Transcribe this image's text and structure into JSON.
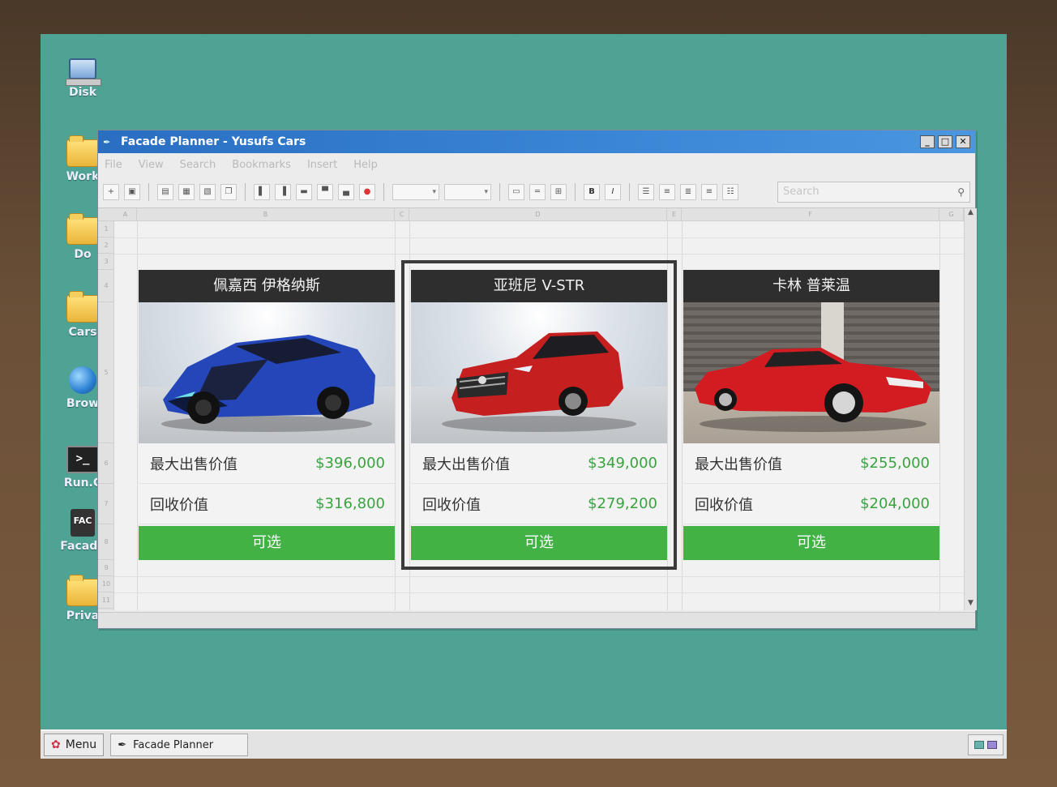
{
  "desktop": {
    "icons": [
      {
        "label": "Disk",
        "icon": "computer-icon"
      },
      {
        "label": "Work",
        "icon": "folder-icon"
      },
      {
        "label": "Do",
        "icon": "folder-icon"
      },
      {
        "label": "Cars",
        "icon": "folder-icon"
      },
      {
        "label": "Brow",
        "icon": "globe-icon"
      },
      {
        "label": "Run.C",
        "icon": "terminal-icon"
      },
      {
        "label": "Facade",
        "icon": "facade-icon"
      },
      {
        "label": "Priva",
        "icon": "folder-icon"
      }
    ]
  },
  "window": {
    "title": "Facade Planner - Yusufs Cars",
    "menu": [
      "File",
      "View",
      "Search",
      "Bookmarks",
      "Insert",
      "Help"
    ],
    "search_placeholder": "Search"
  },
  "sheet": {
    "columns": [
      "A",
      "B",
      "C",
      "D",
      "E",
      "F",
      "G"
    ],
    "rows": [
      "1",
      "2",
      "3",
      "4",
      "5",
      "6",
      "7",
      "8",
      "9",
      "10",
      "11"
    ]
  },
  "cars": [
    {
      "name": "佩嘉西 伊格纳斯",
      "max_sale_label": "最大出售价值",
      "max_sale_value": "$396,000",
      "buyback_label": "回收价值",
      "buyback_value": "$316,800",
      "action": "可选",
      "body_color": "#2446b8",
      "selected": false
    },
    {
      "name": "亚班尼 V-STR",
      "max_sale_label": "最大出售价值",
      "max_sale_value": "$349,000",
      "buyback_label": "回收价值",
      "buyback_value": "$279,200",
      "action": "可选",
      "body_color": "#c61f1f",
      "selected": true
    },
    {
      "name": "卡林 普莱温",
      "max_sale_label": "最大出售价值",
      "max_sale_value": "$255,000",
      "buyback_label": "回收价值",
      "buyback_value": "$204,000",
      "action": "可选",
      "body_color": "#d21c22",
      "selected": false
    }
  ],
  "taskbar": {
    "menu_label": "Menu",
    "task_label": "Facade Planner"
  },
  "colors": {
    "desktop": "#4ea394",
    "accent_green": "#43b244",
    "price_green": "#3aa33f",
    "titlebar": "#2a6ec2"
  }
}
